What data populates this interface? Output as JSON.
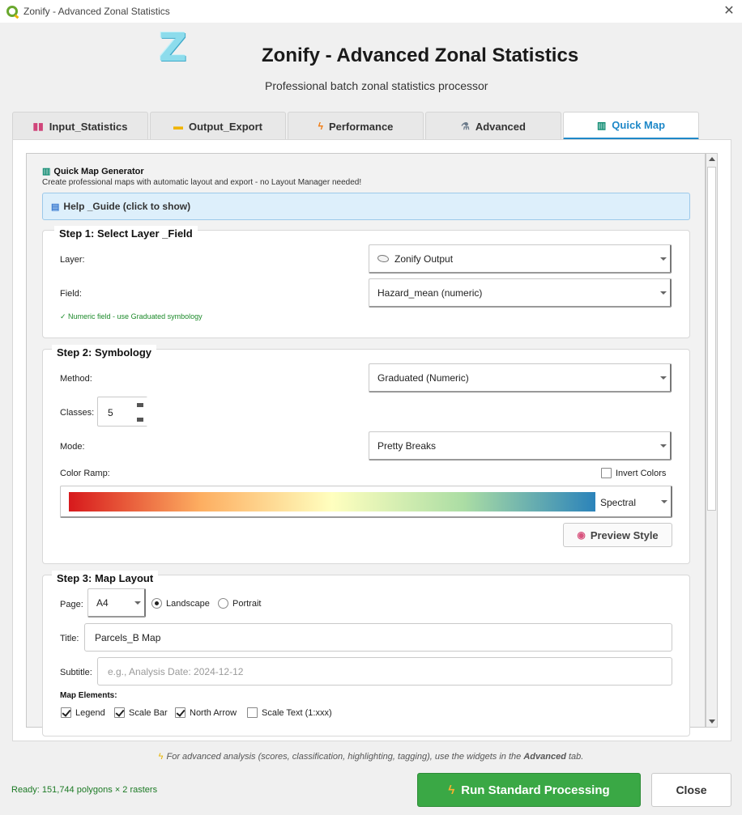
{
  "window": {
    "title": "Zonify - Advanced Zonal Statistics",
    "close_symbol": "✕"
  },
  "header": {
    "logo_letter": "Z",
    "title": "Zonify - Advanced Zonal Statistics",
    "subtitle": "Professional batch zonal statistics processor"
  },
  "tabs": [
    {
      "label": "Input_Statistics",
      "icon": "bar-chart-icon",
      "glyph": "▮▮",
      "active": false
    },
    {
      "label": "Output_Export",
      "icon": "folder-icon",
      "glyph": "▬",
      "active": false
    },
    {
      "label": "Performance",
      "icon": "lightning-icon",
      "glyph": "ϟ",
      "active": false
    },
    {
      "label": "Advanced",
      "icon": "microscope-icon",
      "glyph": "⚗",
      "active": false
    },
    {
      "label": "Quick Map",
      "icon": "map-icon",
      "glyph": "▥",
      "active": true
    }
  ],
  "quick_map": {
    "title": "Quick Map Generator",
    "description": "Create professional maps with automatic layout and export - no Layout Manager needed!",
    "help_label": "Help _Guide (click to show)"
  },
  "step1": {
    "title": "Step 1: Select Layer _Field",
    "layer_label": "Layer:",
    "layer_value": "Zonify Output",
    "field_label": "Field:",
    "field_value": "Hazard_mean (numeric)",
    "hint": "✓ Numeric field - use Graduated symbology"
  },
  "step2": {
    "title": "Step 2: Symbology",
    "method_label": "Method:",
    "method_value": "Graduated (Numeric)",
    "classes_label": "Classes:",
    "classes_value": "5",
    "mode_label": "Mode:",
    "mode_value": "Pretty Breaks",
    "ramp_label": "Color Ramp:",
    "invert_label": "Invert Colors",
    "invert_checked": false,
    "ramp_name": "Spectral",
    "ramp_colors": [
      "#d7191c",
      "#fdae61",
      "#ffffbf",
      "#abdda4",
      "#2b83ba"
    ],
    "preview_label": "Preview Style"
  },
  "step3": {
    "title": "Step 3: Map Layout",
    "page_label": "Page:",
    "page_value": "A4",
    "orientation_landscape": "Landscape",
    "orientation_portrait": "Portrait",
    "orientation_selected": "Landscape",
    "title_label": "Title:",
    "title_value": "Parcels_B Map",
    "subtitle_label": "Subtitle:",
    "subtitle_placeholder": "e.g., Analysis Date: 2024-12-12",
    "elements_label": "Map Elements:",
    "elements": [
      {
        "label": "Legend",
        "checked": true
      },
      {
        "label": "Scale Bar",
        "checked": true
      },
      {
        "label": "North Arrow",
        "checked": true
      },
      {
        "label": "Scale Text (1:xxx)",
        "checked": false
      }
    ]
  },
  "footer": {
    "note_prefix": "For advanced analysis (scores, classification, highlighting, tagging), use the widgets in the ",
    "note_bold": "Advanced",
    "note_suffix": " tab.",
    "status": "Ready: 151,744 polygons × 2 rasters",
    "run_label": "Run Standard Processing",
    "close_label": "Close"
  },
  "colors": {
    "accent": "#1e88c8",
    "run_button": "#3aa845",
    "status_text": "#1c7a25",
    "help_bg": "#ddeffb"
  }
}
